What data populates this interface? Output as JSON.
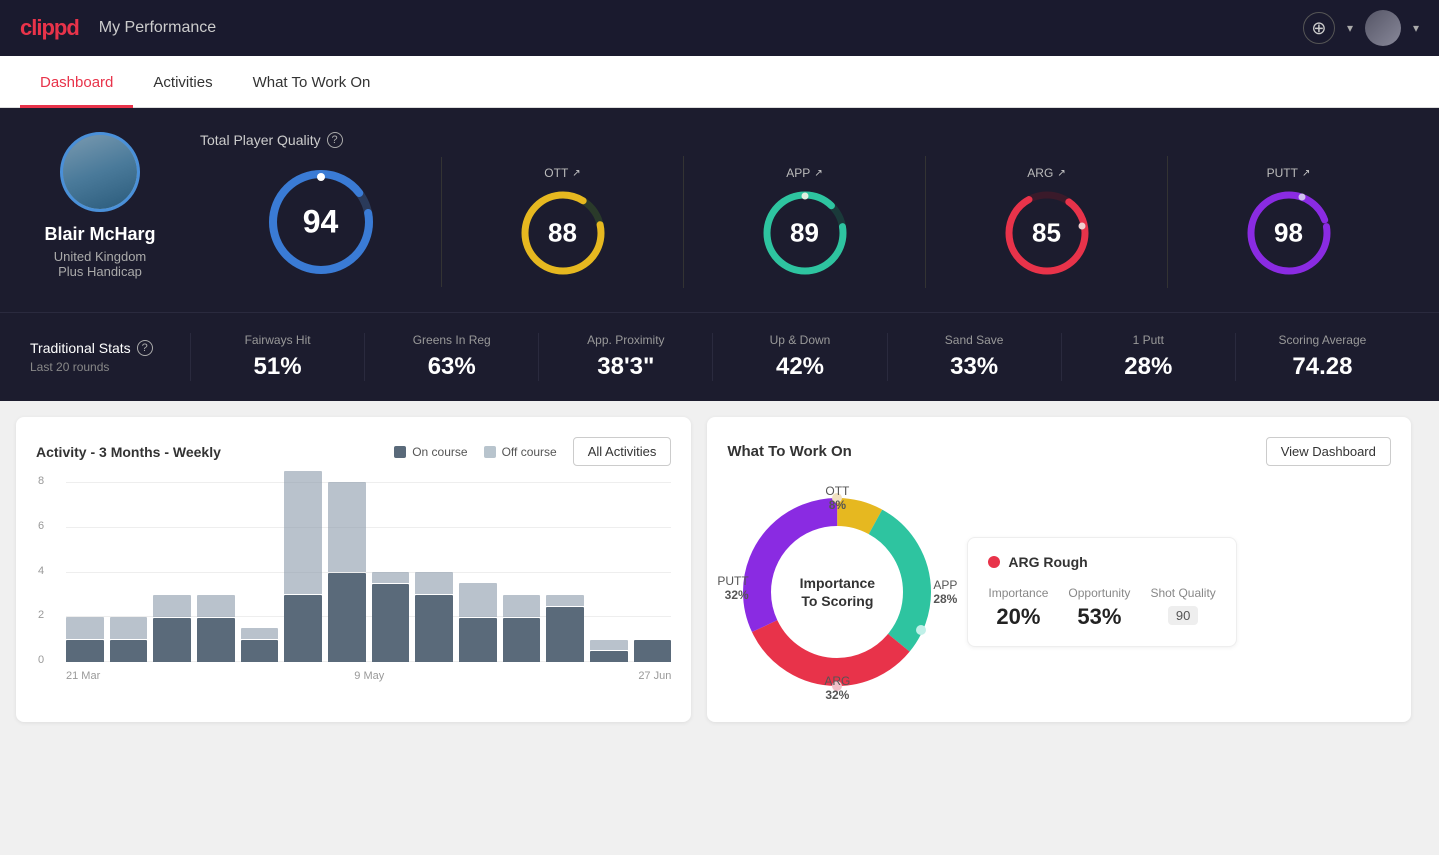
{
  "app": {
    "logo": "clippd",
    "header_title": "My Performance"
  },
  "nav": {
    "tabs": [
      {
        "id": "dashboard",
        "label": "Dashboard",
        "active": true
      },
      {
        "id": "activities",
        "label": "Activities",
        "active": false
      },
      {
        "id": "what-to-work-on",
        "label": "What To Work On",
        "active": false
      }
    ]
  },
  "player": {
    "name": "Blair McHarg",
    "country": "United Kingdom",
    "handicap": "Plus Handicap"
  },
  "scores": {
    "total_quality_label": "Total Player Quality",
    "help": "?",
    "main": {
      "value": "94",
      "color": "#3a7bd5"
    },
    "ott": {
      "label": "OTT",
      "value": "88",
      "color": "#e6b820",
      "arrow": "↗"
    },
    "app": {
      "label": "APP",
      "value": "89",
      "color": "#2ec4a0",
      "arrow": "↗"
    },
    "arg": {
      "label": "ARG",
      "value": "85",
      "color": "#e8334a",
      "arrow": "↗"
    },
    "putt": {
      "label": "PUTT",
      "value": "98",
      "color": "#8a2be2",
      "arrow": "↗"
    }
  },
  "traditional_stats": {
    "title": "Traditional Stats",
    "subtitle": "Last 20 rounds",
    "items": [
      {
        "label": "Fairways Hit",
        "value": "51%"
      },
      {
        "label": "Greens In Reg",
        "value": "63%"
      },
      {
        "label": "App. Proximity",
        "value": "38'3\""
      },
      {
        "label": "Up & Down",
        "value": "42%"
      },
      {
        "label": "Sand Save",
        "value": "33%"
      },
      {
        "label": "1 Putt",
        "value": "28%"
      },
      {
        "label": "Scoring Average",
        "value": "74.28"
      }
    ]
  },
  "activity_chart": {
    "title": "Activity - 3 Months - Weekly",
    "legend_on": "On course",
    "legend_off": "Off course",
    "all_activities_btn": "All Activities",
    "y_labels": [
      "8",
      "6",
      "4",
      "2",
      "0"
    ],
    "x_labels": [
      "21 Mar",
      "9 May",
      "27 Jun"
    ],
    "bars": [
      {
        "on": 1,
        "off": 1
      },
      {
        "on": 1,
        "off": 1
      },
      {
        "on": 2,
        "off": 1
      },
      {
        "on": 2,
        "off": 1
      },
      {
        "on": 1,
        "off": 0.5
      },
      {
        "on": 3,
        "off": 5.5
      },
      {
        "on": 4,
        "off": 4
      },
      {
        "on": 3.5,
        "off": 0.5
      },
      {
        "on": 3,
        "off": 1
      },
      {
        "on": 2,
        "off": 1.5
      },
      {
        "on": 2,
        "off": 1
      },
      {
        "on": 2.5,
        "off": 0.5
      },
      {
        "on": 0.5,
        "off": 0.5
      },
      {
        "on": 1,
        "off": 0
      }
    ]
  },
  "what_to_work_on": {
    "title": "What To Work On",
    "view_dashboard_btn": "View Dashboard",
    "donut_center_line1": "Importance",
    "donut_center_line2": "To Scoring",
    "segments": [
      {
        "label": "OTT",
        "percent": "8%",
        "color": "#e6b820"
      },
      {
        "label": "APP",
        "percent": "28%",
        "color": "#2ec4a0"
      },
      {
        "label": "ARG",
        "percent": "32%",
        "color": "#e8334a"
      },
      {
        "label": "PUTT",
        "percent": "32%",
        "color": "#8a2be2"
      }
    ],
    "detail_card": {
      "title": "ARG Rough",
      "dot_color": "#e8334a",
      "metrics": [
        {
          "label": "Importance",
          "value": "20%"
        },
        {
          "label": "Opportunity",
          "value": "53%"
        },
        {
          "label": "Shot Quality",
          "value": "90",
          "badge": true
        }
      ]
    }
  }
}
